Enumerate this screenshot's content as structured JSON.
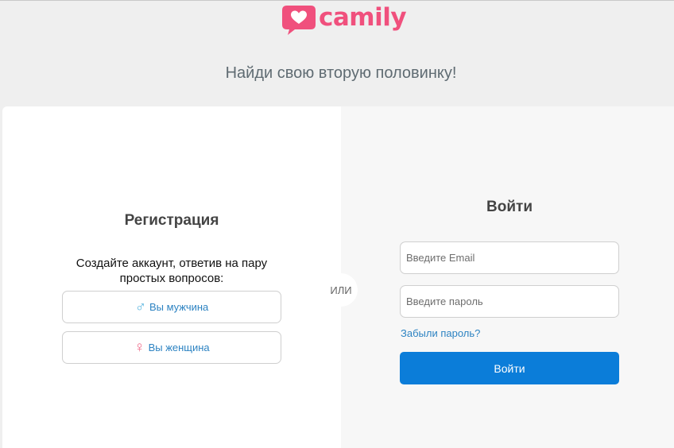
{
  "brand": {
    "name": "camily",
    "color": "#f0507d"
  },
  "tagline": "Найди свою вторую половинку!",
  "registration": {
    "title": "Регистрация",
    "description": "Создайте аккаунт, ответив на пару простых вопросов:",
    "male": {
      "icon": "♂",
      "label": "Вы мужчина",
      "icon_name": "male-icon"
    },
    "female": {
      "icon": "♀",
      "label": "Вы женщина",
      "icon_name": "female-icon"
    }
  },
  "divider": "ИЛИ",
  "login": {
    "title": "Войти",
    "email_placeholder": "Введите Email",
    "password_placeholder": "Введите пароль",
    "forgot_password": "Забыли пароль?",
    "submit": "Войти",
    "submit_color": "#0b7dd9"
  }
}
